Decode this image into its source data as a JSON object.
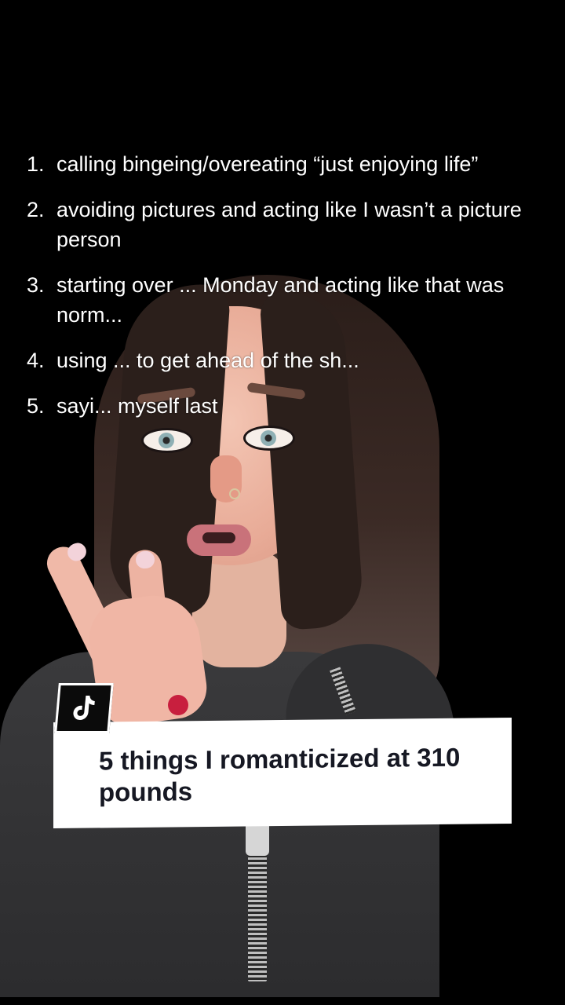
{
  "overlay_list": {
    "items": [
      {
        "number": "1.",
        "text": "calling bingeing/overeating “just enjoying life”"
      },
      {
        "number": "2.",
        "text": "avoiding pictures and acting like I wasn’t a picture person"
      },
      {
        "number": "3.",
        "text": "starting over ... Monday and acting like that was norm..."
      },
      {
        "number": "4.",
        "text": "using ... to get ahead of the sh..."
      },
      {
        "number": "5.",
        "text": "sayi... myself last"
      }
    ]
  },
  "caption": {
    "title": "5 things I romanticized at 310 pounds"
  },
  "brand": {
    "logo_icon": "tiktok-logo-icon"
  },
  "colors": {
    "background": "#000000",
    "card_bg": "#ffffff",
    "card_text": "#161823",
    "list_text": "#ffffff"
  }
}
